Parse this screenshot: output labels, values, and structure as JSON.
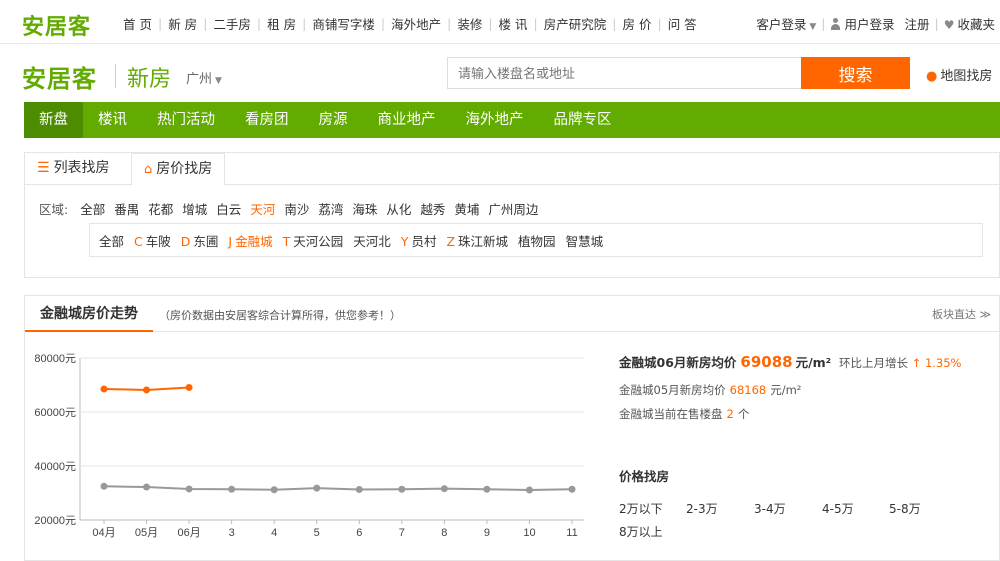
{
  "top": {
    "logo": "安居客",
    "nav": [
      "首 页",
      "新 房",
      "二手房",
      "租 房",
      "商铺写字楼",
      "海外地产",
      "装修",
      "楼 讯",
      "房产研究院",
      "房 价",
      "问 答"
    ],
    "customer_login": "客户登录",
    "user_login": "用户登录",
    "register": "注册",
    "favorites": "收藏夹"
  },
  "header": {
    "logo": "安居客",
    "section": "新房",
    "city": "广州",
    "search_placeholder": "请输入楼盘名或地址",
    "search_button": "搜索",
    "map_search": "地图找房"
  },
  "green_nav": [
    "新盘",
    "楼讯",
    "热门活动",
    "看房团",
    "房源",
    "商业地产",
    "海外地产",
    "品牌专区"
  ],
  "filter": {
    "tab_list": "列表找房",
    "tab_price": "房价找房",
    "region_label": "区域:",
    "regions": [
      "全部",
      "番禺",
      "花都",
      "增城",
      "白云",
      "天河",
      "南沙",
      "荔湾",
      "海珠",
      "从化",
      "越秀",
      "黄埔",
      "广州周边"
    ],
    "selected_region": "天河",
    "subareas": [
      {
        "letter": "",
        "name": "全部"
      },
      {
        "letter": "C",
        "name": "车陂"
      },
      {
        "letter": "D",
        "name": "东圃"
      },
      {
        "letter": "J",
        "name": "金融城"
      },
      {
        "letter": "T",
        "name": "天河公园"
      },
      {
        "letter": "",
        "name": "天河北"
      },
      {
        "letter": "Y",
        "name": "员村"
      },
      {
        "letter": "Z",
        "name": "珠江新城"
      },
      {
        "letter": "",
        "name": "植物园"
      },
      {
        "letter": "",
        "name": "智慧城"
      }
    ],
    "selected_subarea": "金融城"
  },
  "trend": {
    "title": "金融城房价走势",
    "note": "（房价数据由安居客综合计算所得，供您参考！）",
    "quick_link": "板块直达",
    "headline_label": "金融城06月新房均价",
    "headline_value": "69088",
    "headline_unit": "元/m²",
    "mom_label": "环比上月增长",
    "mom_arrow": "↑",
    "mom_value": "1.35%",
    "prev_label": "金融城05月新房均价",
    "prev_value": "68168",
    "prev_unit": "元/m²",
    "onsale_label": "金融城当前在售楼盘",
    "onsale_value": "2",
    "onsale_unit": "个",
    "price_title": "价格找房",
    "price_options": [
      "2万以下",
      "2-3万",
      "3-4万",
      "4-5万",
      "5-8万",
      "8万以上"
    ]
  },
  "colors": {
    "brand_green": "#62ab00",
    "accent_orange": "#ff6600",
    "grey_series": "#999999"
  },
  "chart_data": {
    "type": "line",
    "categories": [
      "04月",
      "05月",
      "06月",
      "3",
      "4",
      "5",
      "6",
      "7",
      "8",
      "9",
      "10",
      "11"
    ],
    "ylim": [
      20000,
      80000
    ],
    "yticks": [
      20000,
      40000,
      60000,
      80000
    ],
    "ytick_labels": [
      "20000元",
      "40000元",
      "60000元",
      "80000元"
    ],
    "series": [
      {
        "values": [
          68500,
          68168,
          69088,
          null,
          null,
          null,
          null,
          null,
          null,
          null,
          null,
          null
        ],
        "color": "#ff6600"
      },
      {
        "values": [
          32500,
          32200,
          31500,
          31400,
          31200,
          31800,
          31300,
          31400,
          31600,
          31400,
          31100,
          31400
        ],
        "color": "#999999"
      }
    ],
    "grid": true
  }
}
